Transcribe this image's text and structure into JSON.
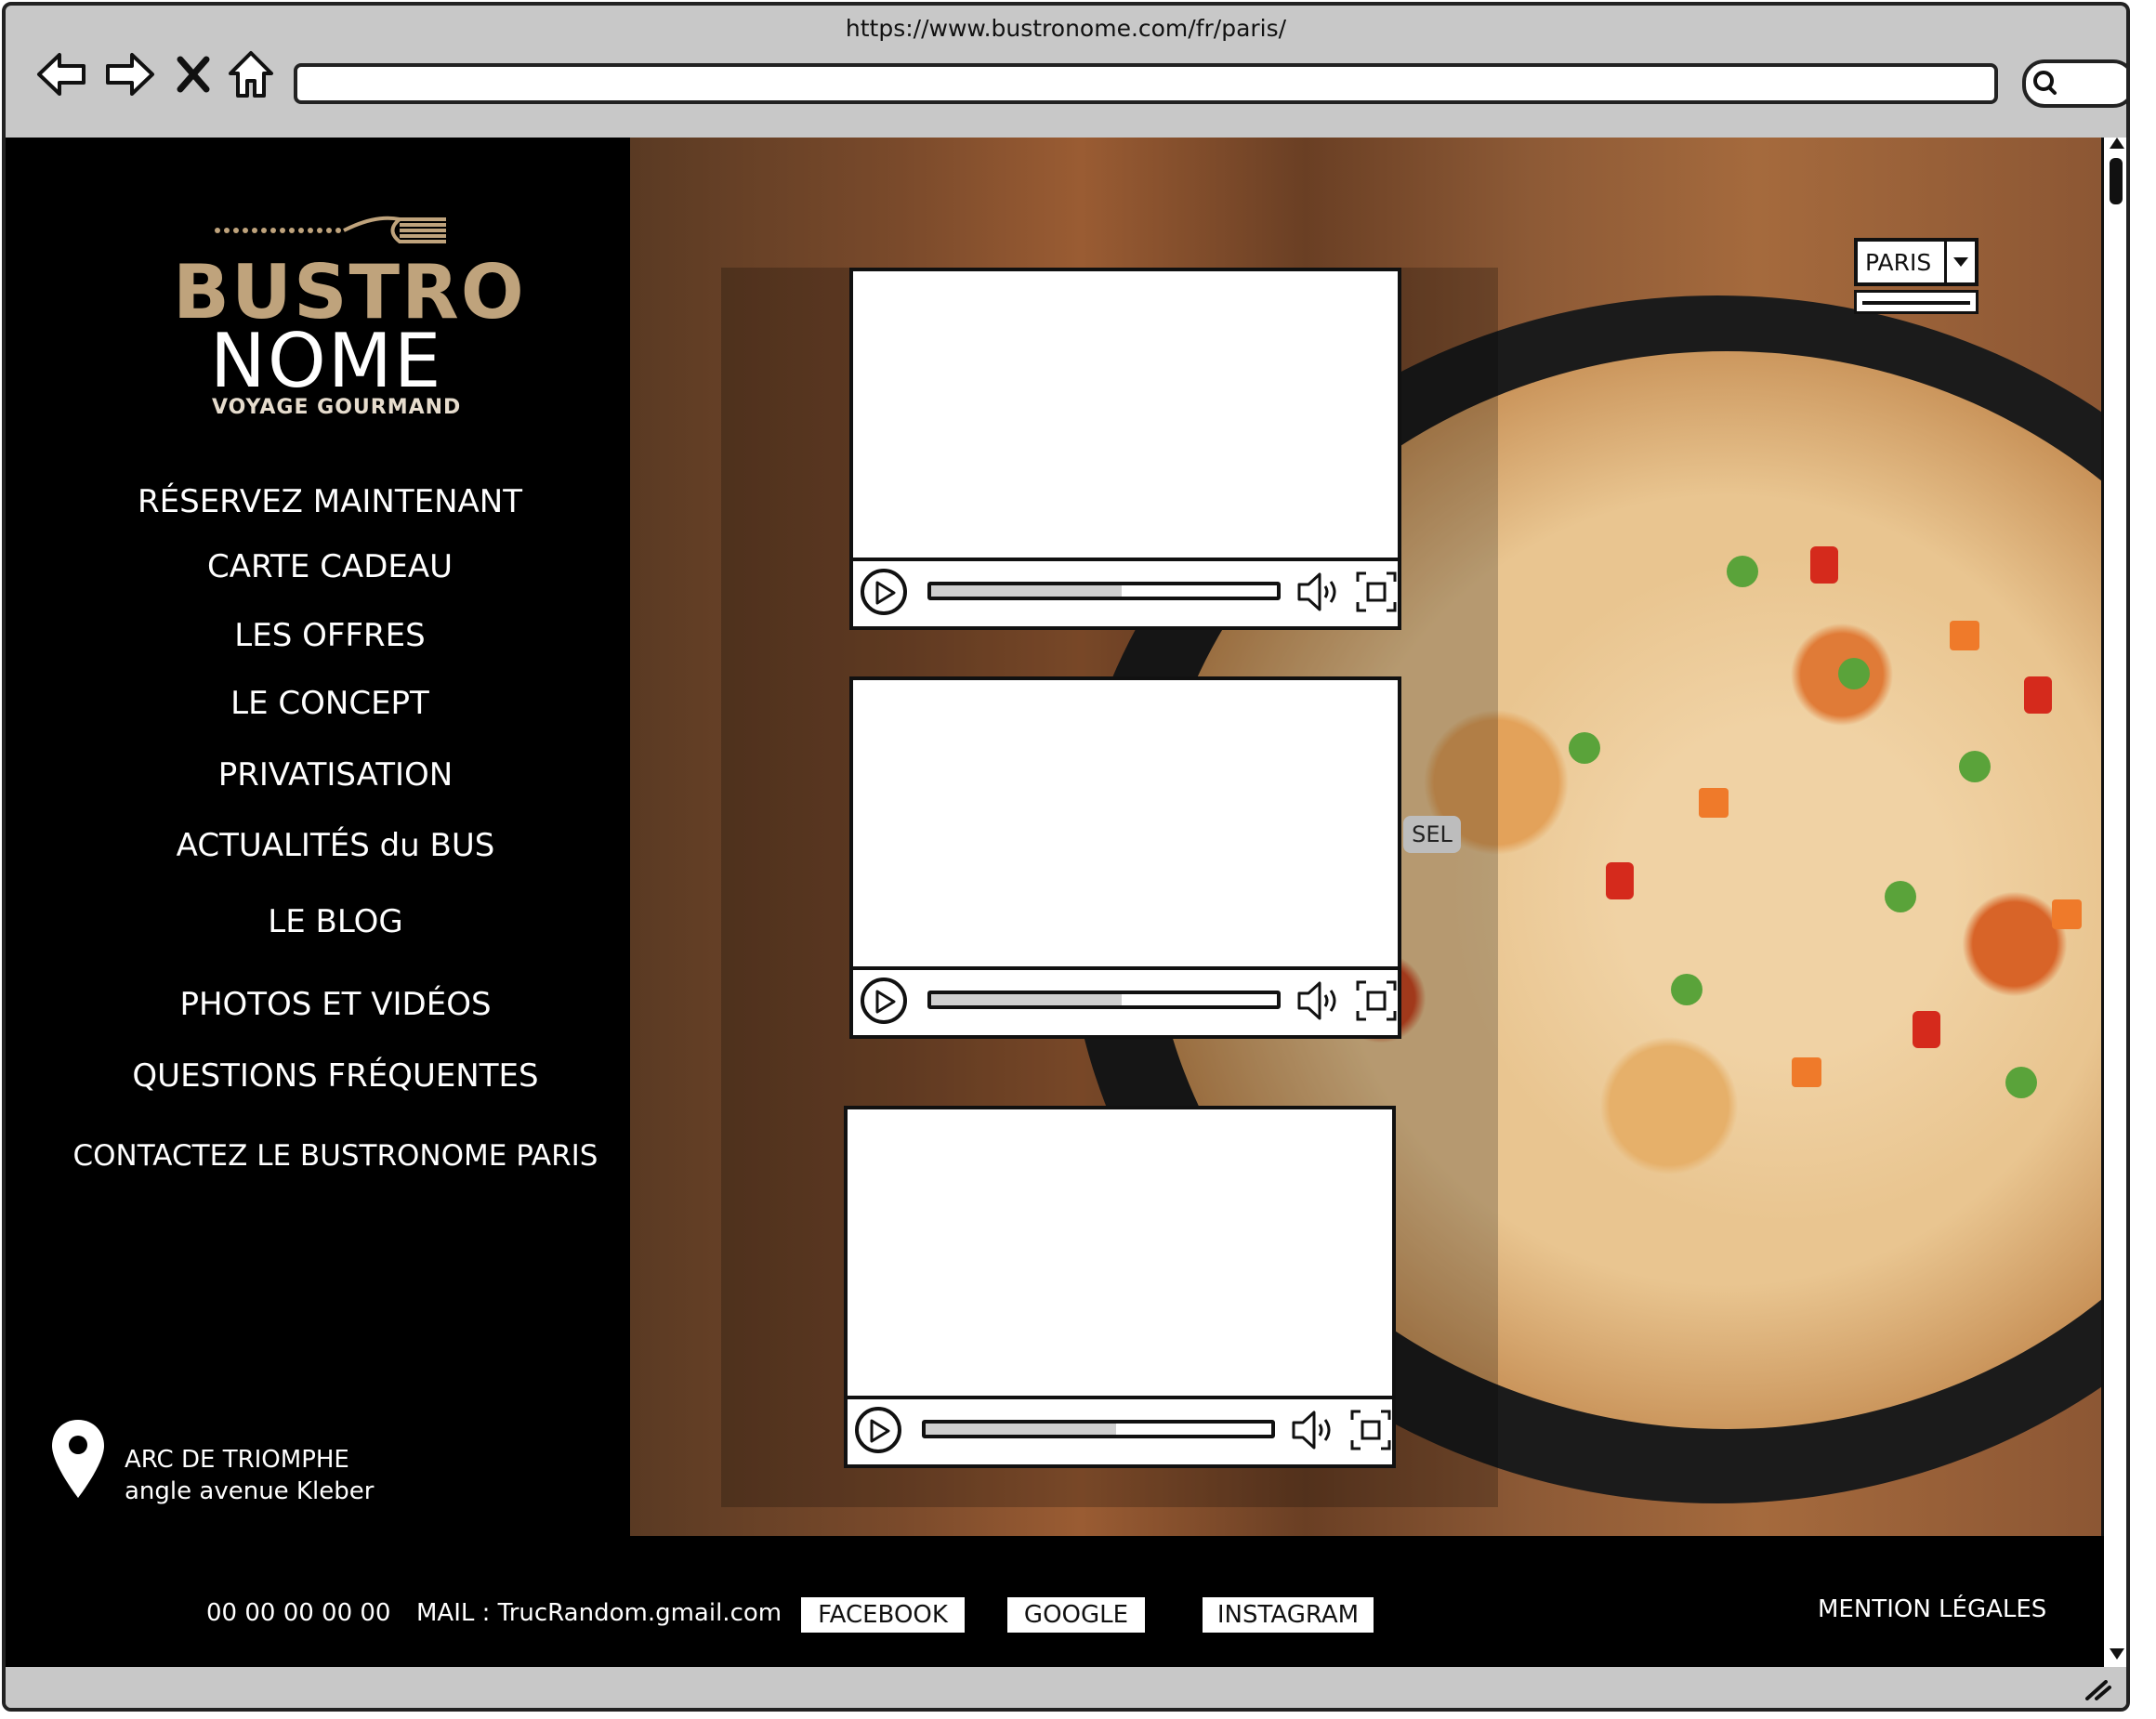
{
  "browser": {
    "url": "https://www.bustronome.com/fr/paris/"
  },
  "logo": {
    "line1": "BUSTRO",
    "line2": "NOME",
    "tagline": "VOYAGE GOURMAND"
  },
  "menu": {
    "items": [
      "RÉSERVEZ MAINTENANT",
      "CARTE CADEAU",
      "LES OFFRES",
      "LE CONCEPT",
      "PRIVATISATION",
      "ACTUALITÉS du BUS",
      "LE BLOG",
      "PHOTOS ET VIDÉOS",
      "QUESTIONS FRÉQUENTES",
      "CONTACTEZ LE BUSTRONOME PARIS"
    ]
  },
  "address": {
    "line1": "ARC DE TRIOMPHE",
    "line2": "angle avenue Kleber"
  },
  "city_select": {
    "value": "PARIS"
  },
  "sel_tag": "SEL",
  "videos": [
    {
      "progress": 0.55
    },
    {
      "progress": 0.55
    },
    {
      "progress": 0.55
    }
  ],
  "footer": {
    "phone": "00 00 00 00 00",
    "mail": "MAIL : TrucRandom.gmail.com",
    "facebook": "FACEBOOK",
    "google": "GOOGLE",
    "instagram": "INSTAGRAM",
    "legal": "MENTION LÉGALES"
  },
  "colors": {
    "logo_gold": "#bfa37c",
    "background": "#000000",
    "chrome": "#c8c8c8"
  }
}
